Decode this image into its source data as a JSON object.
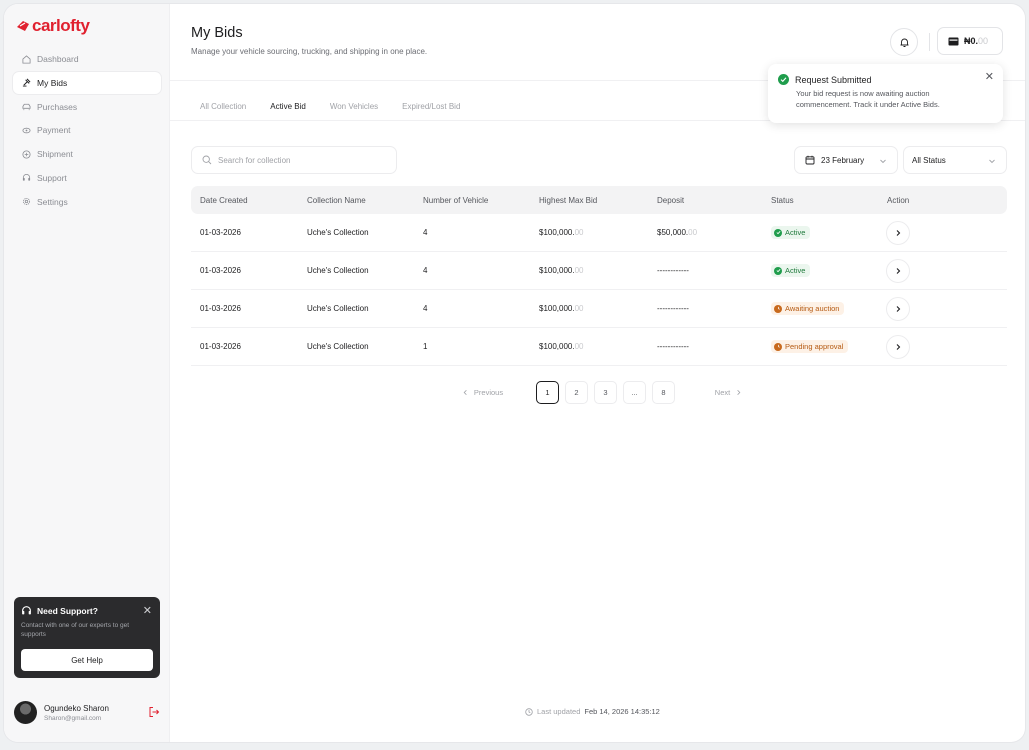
{
  "brand": {
    "name": "carlofty",
    "color": "#e0212f"
  },
  "sidebar": {
    "items": [
      {
        "label": "Dashboard",
        "icon": "home-icon",
        "active": false
      },
      {
        "label": "My Bids",
        "icon": "gavel-icon",
        "active": true
      },
      {
        "label": "Purchases",
        "icon": "car-icon",
        "active": false
      },
      {
        "label": "Payment",
        "icon": "payment-icon",
        "active": false
      },
      {
        "label": "Shipment",
        "icon": "ship-icon",
        "active": false
      },
      {
        "label": "Support",
        "icon": "headset-icon",
        "active": false
      },
      {
        "label": "Settings",
        "icon": "gear-icon",
        "active": false
      }
    ],
    "support_card": {
      "title": "Need Support?",
      "text": "Contact with one of our experts to get supports",
      "button": "Get Help"
    },
    "profile": {
      "name": "Ogundeko Sharon",
      "email": "Sharon@gmail.com"
    }
  },
  "header": {
    "title": "My Bids",
    "subtitle": "Manage your vehicle sourcing, trucking, and shipping in one place.",
    "wallet_main": "₦0.",
    "wallet_dim": "00"
  },
  "tabs": [
    {
      "label": "All Collection",
      "active": false
    },
    {
      "label": "Active Bid",
      "active": true
    },
    {
      "label": "Won Vehicles",
      "active": false
    },
    {
      "label": "Expired/Lost Bid",
      "active": false
    }
  ],
  "toast": {
    "title": "Request Submitted",
    "body": "Your bid request is now awaiting auction commencement. Track it under Active Bids."
  },
  "filters": {
    "search_placeholder": "Search for collection",
    "date": "23 February",
    "status": "All Status"
  },
  "table": {
    "headers": [
      "Date Created",
      "Collection Name",
      "Number of Vehicle",
      "Highest Max Bid",
      "Deposit",
      "Status",
      "Action"
    ],
    "rows": [
      {
        "date": "01-03-2026",
        "name": "Uche's Collection",
        "vehicles": "4",
        "bid_main": "$100,000.",
        "bid_dim": "00",
        "deposit_main": "$50,000.",
        "deposit_dim": "00",
        "status": "Active",
        "status_type": "active"
      },
      {
        "date": "01-03-2026",
        "name": "Uche's Collection",
        "vehicles": "4",
        "bid_main": "$100,000.",
        "bid_dim": "00",
        "deposit_main": "------------",
        "deposit_dim": "",
        "status": "Active",
        "status_type": "active"
      },
      {
        "date": "01-03-2026",
        "name": "Uche's Collection",
        "vehicles": "4",
        "bid_main": "$100,000.",
        "bid_dim": "00",
        "deposit_main": "------------",
        "deposit_dim": "",
        "status": "Awaiting auction",
        "status_type": "await"
      },
      {
        "date": "01-03-2026",
        "name": "Uche's Collection",
        "vehicles": "1",
        "bid_main": "$100,000.",
        "bid_dim": "00",
        "deposit_main": "------------",
        "deposit_dim": "",
        "status": "Pending approval",
        "status_type": "pending"
      }
    ]
  },
  "pagination": {
    "previous": "Previous",
    "next": "Next",
    "pages": [
      "1",
      "2",
      "3",
      "...",
      "8"
    ],
    "current": "1"
  },
  "footer": {
    "updated_label": "Last updated",
    "updated_value": "Feb 14, 2026 14:35:12"
  },
  "colors": {
    "success": "#1f9d4c",
    "warning": "#b55a12",
    "dark": "#2b2b2d"
  }
}
